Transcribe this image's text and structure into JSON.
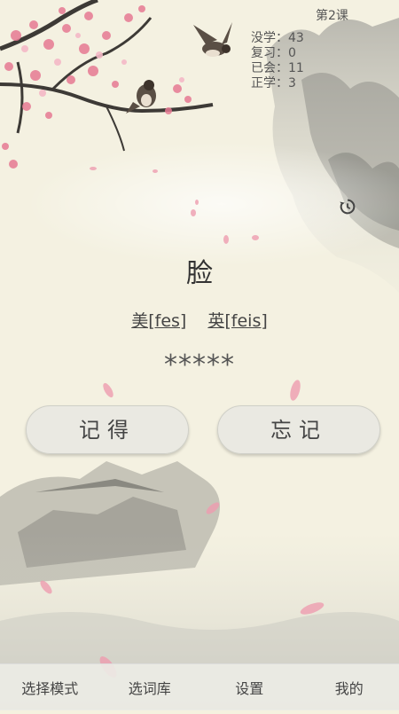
{
  "header": {
    "lesson": "第2课",
    "stats": [
      "没学：43",
      "复习：0",
      "已会：11",
      "正学：3"
    ]
  },
  "card": {
    "word": "脸",
    "phonetic_us": "美[fes]",
    "phonetic_uk": "英[feis]",
    "masked_meaning": "*****"
  },
  "actions": {
    "remember_label": "记得",
    "forget_label": "忘记"
  },
  "tabbar": {
    "items": [
      "选择模式",
      "选词库",
      "设置",
      "我的"
    ]
  },
  "colors": {
    "background": "#f5f1df",
    "blossom": "#e67a93",
    "button": "#e8e8e2"
  },
  "icons": {
    "history": "history-icon"
  }
}
